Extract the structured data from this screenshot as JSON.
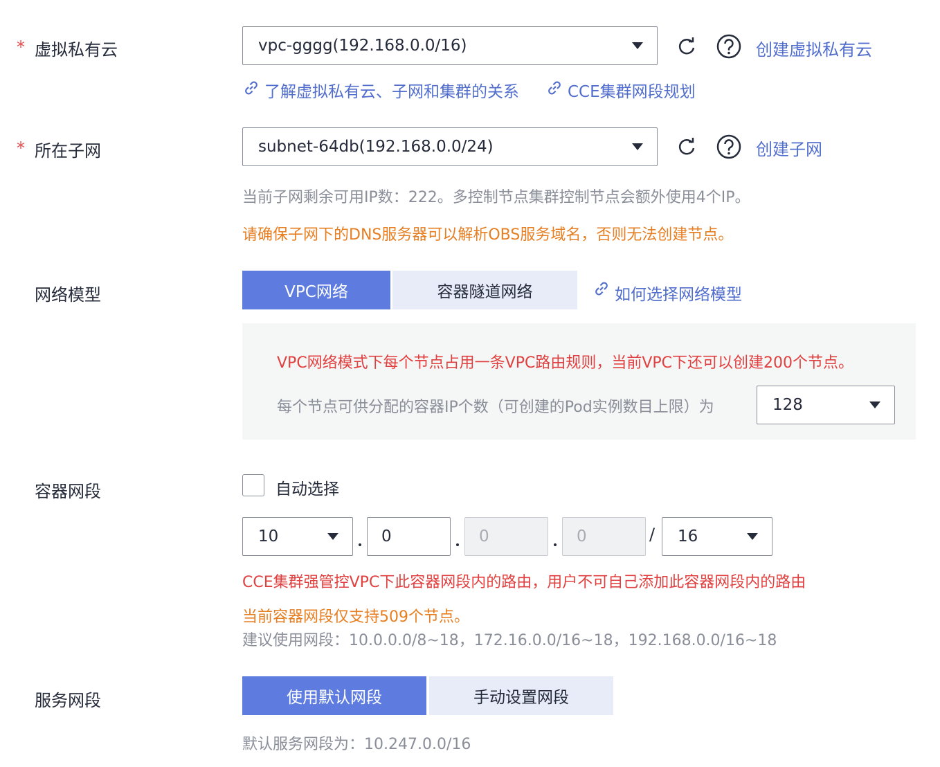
{
  "vpc": {
    "label": "虚拟私有云",
    "required_mark": "*",
    "selected": "vpc-gggg(192.168.0.0/16)",
    "create_link": "创建虚拟私有云",
    "help_link_1": "了解虚拟私有云、子网和集群的关系",
    "help_link_2": "CCE集群网段规划"
  },
  "subnet": {
    "label": "所在子网",
    "required_mark": "*",
    "selected": "subnet-64db(192.168.0.0/24)",
    "create_link": "创建子网",
    "hint": "当前子网剩余可用IP数：222。多控制节点集群控制节点会额外使用4个IP。",
    "warning": "请确保子网下的DNS服务器可以解析OBS服务域名，否则无法创建节点。"
  },
  "network_model": {
    "label": "网络模型",
    "options": [
      "VPC网络",
      "容器隧道网络"
    ],
    "active_index": 0,
    "help_link": "如何选择网络模型",
    "panel_warning": "VPC网络模式下每个节点占用一条VPC路由规则，当前VPC下还可以创建200个节点。",
    "panel_ip_label": "每个节点可供分配的容器IP个数（可创建的Pod实例数目上限）为",
    "panel_ip_value": "128"
  },
  "container_cidr": {
    "label": "容器网段",
    "auto_select_label": "自动选择",
    "auto_select_checked": false,
    "octet1": "10",
    "octet2": "0",
    "octet3": "0",
    "octet4": "0",
    "separator_dot": ".",
    "separator_slash": "/",
    "mask": "16",
    "warning_red": "CCE集群强管控VPC下此容器网段内的路由，用户不可自己添加此容器网段内的路由",
    "warning_orange": "当前容器网段仅支持509个节点。",
    "suggestion": "建议使用网段：10.0.0.0/8~18，172.16.0.0/16~18，192.168.0.0/16~18"
  },
  "service_cidr": {
    "label": "服务网段",
    "options": [
      "使用默认网段",
      "手动设置网段"
    ],
    "active_index": 0,
    "hint": "默认服务网段为：10.247.0.0/16"
  },
  "colors": {
    "primary": "#5e7ce0",
    "link": "#526ecc",
    "required": "#e94b4b",
    "warning_orange": "#e67e22",
    "warning_red": "#e0403f",
    "hint_gray": "#8a8e99"
  },
  "icons": [
    "refresh-icon",
    "help-icon",
    "link-icon",
    "chevron-down-icon"
  ]
}
